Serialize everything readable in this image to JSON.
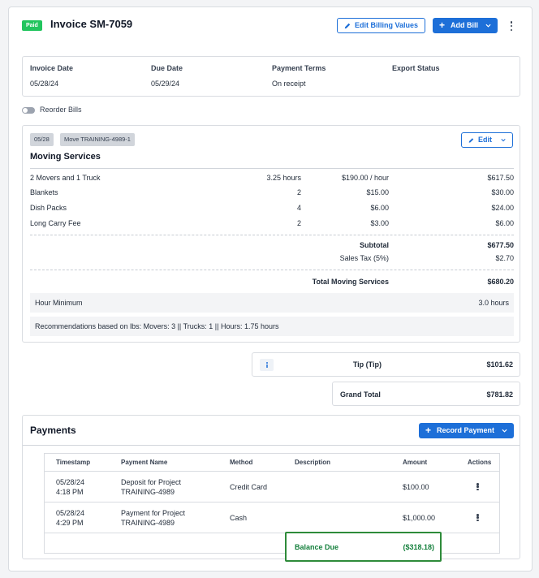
{
  "header": {
    "status_badge": "Paid",
    "title": "Invoice SM-7059",
    "edit_billing_label": "Edit Billing Values",
    "add_bill_label": "Add Bill"
  },
  "info": {
    "invoice_date_label": "Invoice Date",
    "invoice_date": "05/28/24",
    "due_date_label": "Due Date",
    "due_date": "05/29/24",
    "payment_terms_label": "Payment Terms",
    "payment_terms": "On receipt",
    "export_status_label": "Export Status",
    "export_status": ""
  },
  "reorder": {
    "label": "Reorder Bills",
    "enabled": false
  },
  "bill": {
    "date_chip": "05/28",
    "move_chip": "Move TRAINING-4989-1",
    "edit_label": "Edit",
    "section_title": "Moving Services",
    "items": [
      {
        "name": "2 Movers and 1 Truck",
        "qty": "3.25 hours",
        "rate": "$190.00 / hour",
        "total": "$617.50"
      },
      {
        "name": "Blankets",
        "qty": "2",
        "rate": "$15.00",
        "total": "$30.00"
      },
      {
        "name": "Dish Packs",
        "qty": "4",
        "rate": "$6.00",
        "total": "$24.00"
      },
      {
        "name": "Long Carry Fee",
        "qty": "2",
        "rate": "$3.00",
        "total": "$6.00"
      }
    ],
    "subtotal_label": "Subtotal",
    "subtotal": "$677.50",
    "sales_tax_label": "Sales Tax (5%)",
    "sales_tax": "$2.70",
    "total_label": "Total Moving Services",
    "total": "$680.20",
    "hour_minimum_label": "Hour Minimum",
    "hour_minimum": "3.0 hours",
    "recommendations": "Recommendations based on lbs:  Movers: 3 || Trucks: 1 || Hours: 1.75 hours"
  },
  "tip": {
    "label": "Tip (Tip)",
    "value": "$101.62"
  },
  "grand_total": {
    "label": "Grand Total",
    "value": "$781.82"
  },
  "payments": {
    "title": "Payments",
    "record_label": "Record Payment",
    "columns": [
      "Timestamp",
      "Payment Name",
      "Method",
      "Description",
      "Amount",
      "Actions"
    ],
    "rows": [
      {
        "date": "05/28/24",
        "time": "4:18 PM",
        "name1": "Deposit for Project",
        "name2": "TRAINING-4989",
        "method": "Credit Card",
        "description": "",
        "amount": "$100.00"
      },
      {
        "date": "05/28/24",
        "time": "4:29 PM",
        "name1": "Payment for Project",
        "name2": "TRAINING-4989",
        "method": "Cash",
        "description": "",
        "amount": "$1,000.00"
      }
    ],
    "balance_due_label": "Balance Due",
    "balance_due": "($318.18)"
  },
  "colors": {
    "accent": "#1d6fd8",
    "paid": "#22c55e",
    "balance": "#15803d"
  }
}
